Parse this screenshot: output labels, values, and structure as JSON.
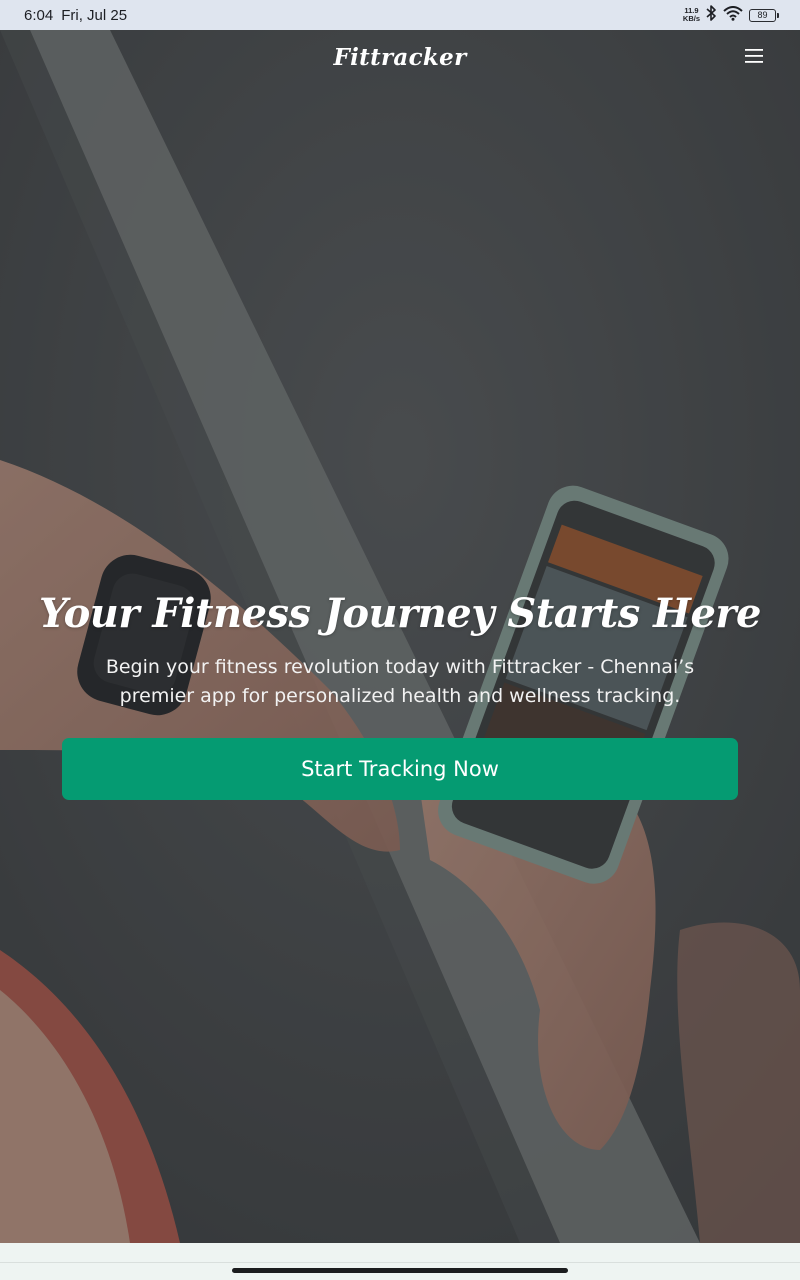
{
  "status_bar": {
    "time": "6:04",
    "date": "Fri, Jul 25",
    "net_speed_value": "11.9",
    "net_speed_unit": "KB/s",
    "battery_level": "89",
    "icons": [
      "bluetooth-icon",
      "wifi-icon",
      "battery-icon"
    ]
  },
  "navbar": {
    "brand": "Fittracker",
    "menu_icon": "hamburger-menu-icon"
  },
  "hero": {
    "title": "Your Fitness Journey Starts Here",
    "subtitle": "Begin your fitness revolution today with Fittracker - Chennai’s premier app for personalized health and wellness tracking.",
    "cta_label": "Start Tracking Now"
  },
  "colors": {
    "accent": "#059b72",
    "status_bar_bg": "#dfe5ef",
    "page_bg": "#eef4f2"
  }
}
